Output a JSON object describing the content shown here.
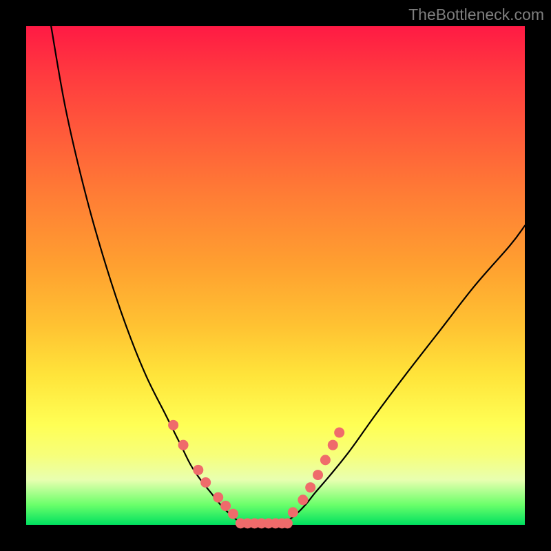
{
  "watermark": "TheBottleneck.com",
  "colors": {
    "frame": "#000000",
    "curve": "#000000",
    "dots": "#ef6b6b",
    "gradient_stops": [
      "#ff1a44",
      "#ff3b3f",
      "#ff5c3a",
      "#ff7d35",
      "#ffa030",
      "#ffc232",
      "#ffe43a",
      "#ffff55",
      "#f7ff7a",
      "#e8ffb0",
      "#6aff6a",
      "#00e060"
    ]
  },
  "chart_data": {
    "type": "line",
    "title": "",
    "xlabel": "",
    "ylabel": "",
    "x_range": [
      0,
      100
    ],
    "y_range": [
      0,
      100
    ],
    "series": [
      {
        "name": "left-curve",
        "x": [
          5,
          8,
          12,
          16,
          20,
          24,
          28,
          31,
          33,
          35,
          37,
          39,
          41,
          43
        ],
        "y": [
          100,
          83,
          66,
          52,
          40,
          30,
          22,
          16,
          12,
          9,
          6.5,
          4,
          2,
          0.5
        ]
      },
      {
        "name": "right-curve",
        "x": [
          52,
          54,
          56,
          58,
          61,
          65,
          70,
          76,
          83,
          90,
          97,
          100
        ],
        "y": [
          0.5,
          2,
          4,
          6.5,
          10,
          15,
          22,
          30,
          39,
          48,
          56,
          60
        ]
      },
      {
        "name": "flat-bottom",
        "x": [
          43,
          45,
          47,
          49,
          51,
          52
        ],
        "y": [
          0.5,
          0,
          0,
          0,
          0,
          0.5
        ]
      }
    ],
    "left_markers": [
      {
        "x": 29.5,
        "y": 20
      },
      {
        "x": 31.5,
        "y": 16
      },
      {
        "x": 34.5,
        "y": 11
      },
      {
        "x": 36,
        "y": 8.5
      },
      {
        "x": 38.5,
        "y": 5.5
      },
      {
        "x": 40,
        "y": 3.8
      },
      {
        "x": 41.5,
        "y": 2.2
      }
    ],
    "right_markers": [
      {
        "x": 53.5,
        "y": 2.5
      },
      {
        "x": 55.5,
        "y": 5
      },
      {
        "x": 57,
        "y": 7.5
      },
      {
        "x": 58.5,
        "y": 10
      },
      {
        "x": 60,
        "y": 13
      },
      {
        "x": 61.5,
        "y": 16
      },
      {
        "x": 62.8,
        "y": 18.5
      }
    ],
    "bottom_beads_x": [
      43.0,
      44.4,
      45.8,
      47.2,
      48.6,
      50.0,
      51.3,
      52.4
    ]
  }
}
